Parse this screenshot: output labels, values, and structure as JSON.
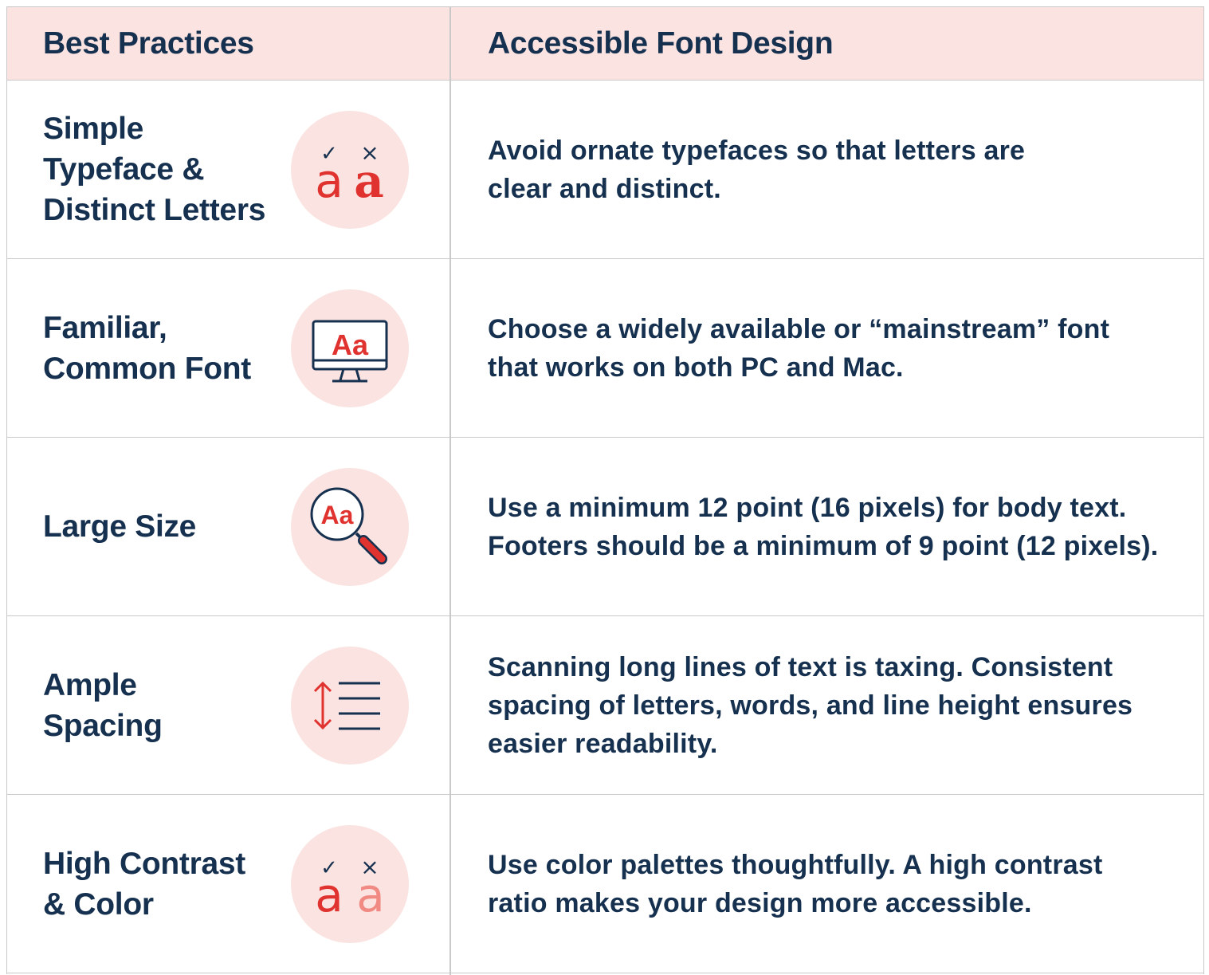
{
  "header": {
    "left": "Best Practices",
    "right": "Accessible Font Design"
  },
  "rows": [
    {
      "title": "Simple\nTypeface &\nDistinct Letters",
      "description": "Avoid ornate typefaces so that letters are\nclear and distinct.",
      "icon": "check-cross-letters-icon",
      "glyph_a": "a",
      "glyph_b": "a",
      "check": "✓",
      "cross": "×"
    },
    {
      "title": "Familiar,\nCommon Font",
      "description": "Choose a widely available or “mainstream” font\nthat works on both PC and Mac.",
      "icon": "monitor-icon",
      "glyph": "Aa"
    },
    {
      "title": "Large Size",
      "description": "Use a minimum 12 point (16 pixels) for body text.\nFooters should be a minimum of 9 point (12 pixels).",
      "icon": "magnifier-icon",
      "glyph": "Aa"
    },
    {
      "title": "Ample\nSpacing",
      "description": "Scanning long lines of text is taxing. Consistent\nspacing of letters, words, and line height ensures\neasier readability.",
      "icon": "line-spacing-icon"
    },
    {
      "title": "High Contrast\n& Color",
      "description": "Use color palettes thoughtfully.  A high contrast\nratio makes your design more accessible.",
      "icon": "contrast-letters-icon",
      "glyph_a": "a",
      "glyph_b": "a",
      "check": "✓",
      "cross": "×"
    }
  ],
  "colors": {
    "navy": "#16304f",
    "red": "#e0322e",
    "light_red": "#f08a82",
    "pink_bg": "#fae3e1",
    "border": "#c9c9c9"
  }
}
